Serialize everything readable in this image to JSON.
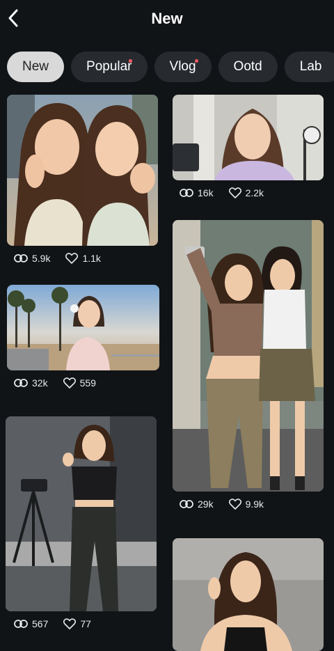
{
  "header": {
    "title": "New"
  },
  "tabs": [
    {
      "label": "New",
      "active": true,
      "dot": false
    },
    {
      "label": "Popular",
      "active": false,
      "dot": true
    },
    {
      "label": "Vlog",
      "active": false,
      "dot": true
    },
    {
      "label": "Ootd",
      "active": false,
      "dot": false
    },
    {
      "label": "Lab",
      "active": false,
      "dot": false
    }
  ],
  "cards": [
    {
      "views": "5.9k",
      "likes": "1.1k"
    },
    {
      "views": "16k",
      "likes": "2.2k"
    },
    {
      "views": "32k",
      "likes": "559"
    },
    {
      "views": "29k",
      "likes": "9.9k"
    },
    {
      "views": "567",
      "likes": "77"
    }
  ],
  "colors": {
    "background": "#111417",
    "tab_bg": "#272b30",
    "tab_active": "#d9d9d9",
    "dot": "#ff5a5f"
  }
}
